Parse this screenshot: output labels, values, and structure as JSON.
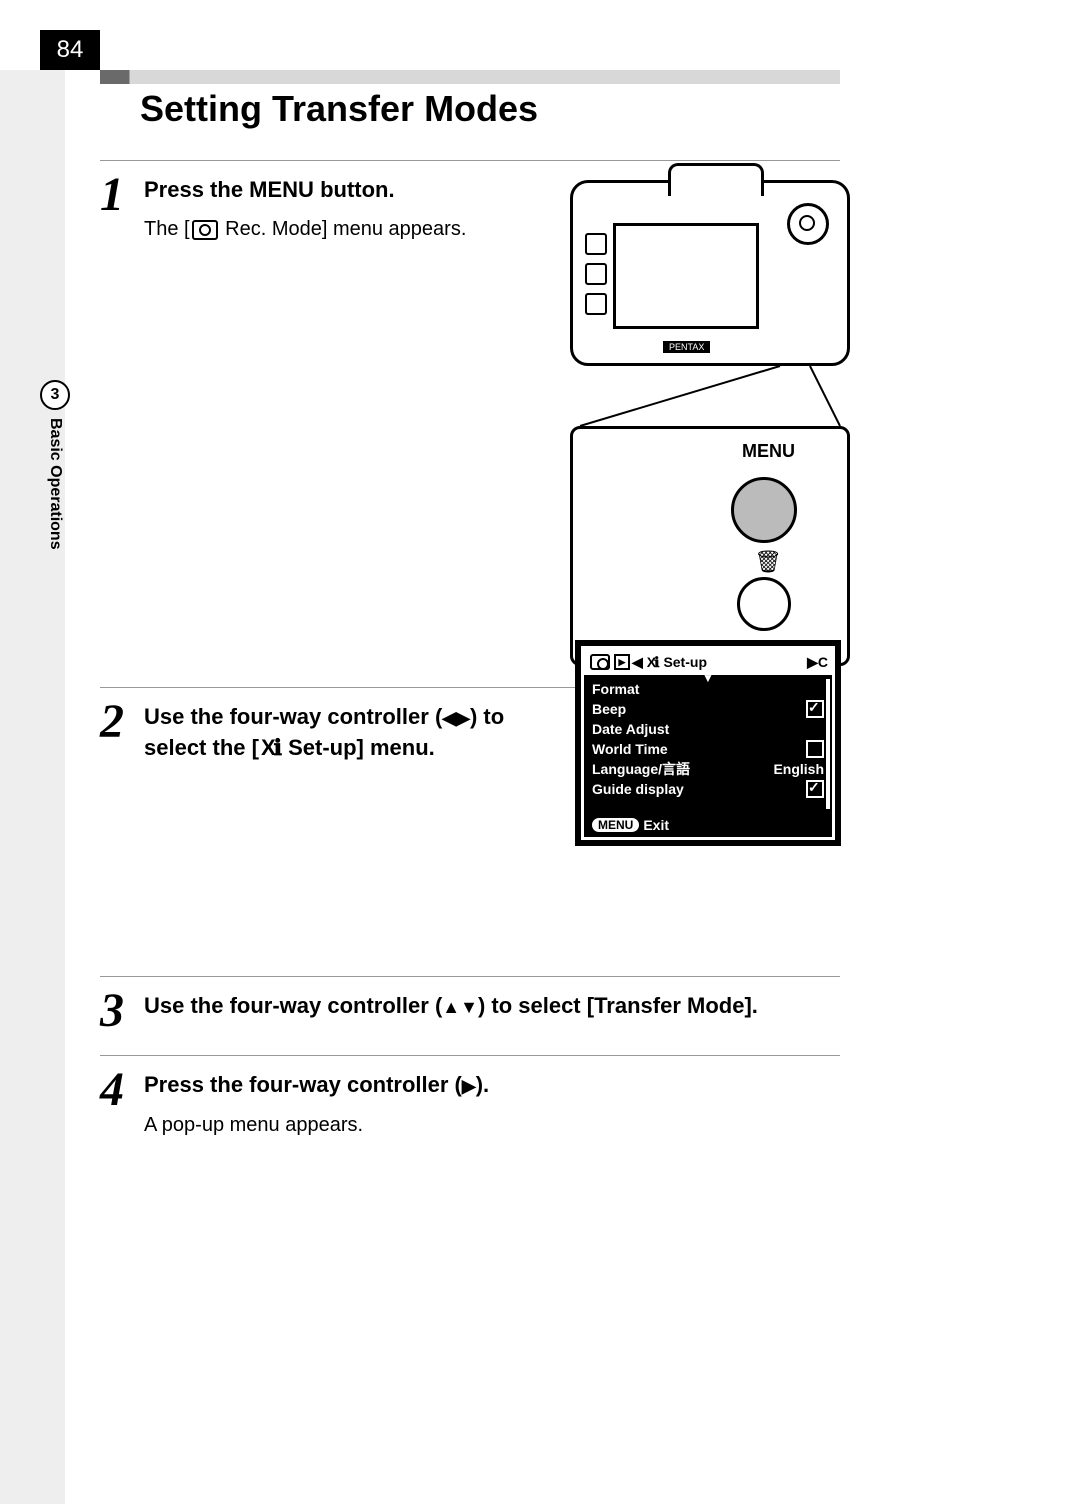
{
  "page_number": "84",
  "chapter": {
    "number": "3",
    "label": "Basic Operations"
  },
  "section_title": "Setting Transfer Modes",
  "steps": [
    {
      "num": "1",
      "heading_pre": "Press the ",
      "heading_key": "MENU",
      "heading_post": " button.",
      "body_pre": "The [",
      "body_post": " Rec. Mode] menu appears."
    },
    {
      "num": "2",
      "heading": "Use the four-way controller (◀▶) to select the [ Set-up] menu."
    },
    {
      "num": "3",
      "heading": "Use the four-way controller (▲▼) to select [Transfer Mode]."
    },
    {
      "num": "4",
      "heading": "Press the four-way controller (▶).",
      "body": "A pop-up menu appears."
    }
  ],
  "camera": {
    "brand": "PENTAX",
    "menu_label": "MENU",
    "trash": "🗑"
  },
  "lcd": {
    "tab_title": "Set-up",
    "tab_nav_right": "▶C",
    "arrow_down": "▼",
    "items": [
      {
        "label": "Format",
        "value": ""
      },
      {
        "label": "Beep",
        "checked": true
      },
      {
        "label": "Date Adjust",
        "value": ""
      },
      {
        "label": "World Time",
        "checked": false
      },
      {
        "label": "Language/言語",
        "value": "English"
      },
      {
        "label": "Guide display",
        "checked": true
      }
    ],
    "footer_key": "MENU",
    "footer_label": "Exit"
  }
}
